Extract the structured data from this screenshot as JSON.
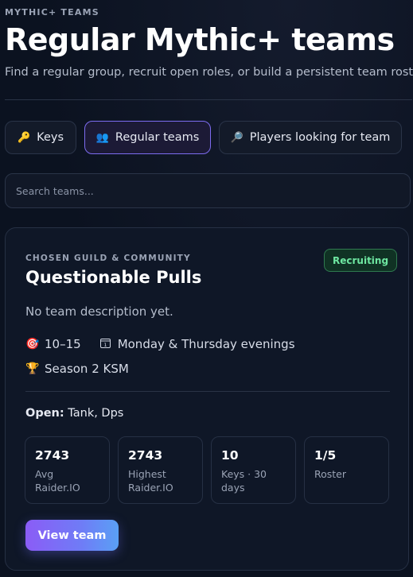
{
  "header": {
    "eyebrow": "MYTHIC+ TEAMS",
    "title": "Regular Mythic+ teams",
    "subtitle": "Find a regular group, recruit open roles, or build a persistent team roster."
  },
  "tabs": [
    {
      "label": "Keys",
      "icon": "key-icon",
      "glyph": "🔑",
      "active": false
    },
    {
      "label": "Regular teams",
      "icon": "people-icon",
      "glyph": "👥",
      "active": true
    },
    {
      "label": "Players looking for team",
      "icon": "magnifier-icon",
      "glyph": "🔎",
      "active": false
    }
  ],
  "search": {
    "placeholder": "Search teams...",
    "value": ""
  },
  "team_card": {
    "eyebrow": "CHOSEN GUILD & COMMUNITY",
    "title": "Questionable Pulls",
    "status": "Recruiting",
    "description": "No team description yet.",
    "key_range": "10–15",
    "key_range_icon": "target-icon",
    "schedule": "Monday & Thursday evenings",
    "schedule_icon": "calendar-icon",
    "goal": "Season 2 KSM",
    "goal_icon": "trophy-icon",
    "open_label": "Open:",
    "open_roles": "Tank, Dps",
    "stats": [
      {
        "value": "2743",
        "label": "Avg Raider.IO"
      },
      {
        "value": "2743",
        "label": "Highest Raider.IO"
      },
      {
        "value": "10",
        "label": "Keys · 30 days"
      },
      {
        "value": "1/5",
        "label": "Roster"
      }
    ],
    "button_label": "View team"
  },
  "colors": {
    "background": "#0b1220",
    "accent_purple": "#8b5cf6",
    "accent_blue": "#5aa0f5",
    "recruiting_green": "#6ee7a1"
  }
}
